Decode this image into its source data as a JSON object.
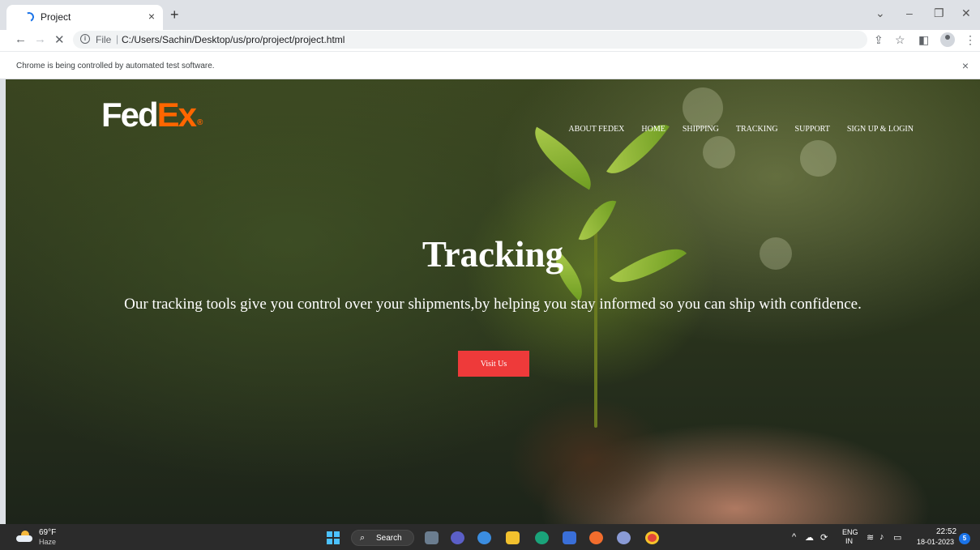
{
  "browser": {
    "tab_title": "Project",
    "tab_close": "×",
    "new_tab": "+",
    "url_scheme_label": "File",
    "url": "C:/Users/Sachin/Desktop/us/pro/project/project.html",
    "infobar_message": "Chrome is being controlled by automated test software.",
    "infobar_close": "×"
  },
  "site": {
    "logo_fed": "Fed",
    "logo_ex": "Ex",
    "logo_mark": "®",
    "nav": [
      "ABOUT FEDEX",
      "HOME",
      "SHIPPING",
      "TRACKING",
      "SUPPORT",
      "SIGN UP & LOGIN"
    ],
    "hero_title": "Tracking",
    "hero_subtitle": "Our tracking tools give you control over your shipments,by helping you stay informed so you can ship with confidence.",
    "cta_label": "Visit Us"
  },
  "taskbar": {
    "weather_temp": "69°F",
    "weather_condition": "Haze",
    "search_label": "Search",
    "language": "ENG",
    "region": "IN",
    "time": "22:52",
    "date": "18-01-2023",
    "notification_count": "5"
  },
  "colors": {
    "fedex_orange": "#ff6600",
    "cta_red": "#ee3a3a",
    "accent_blue": "#1a73e8"
  }
}
